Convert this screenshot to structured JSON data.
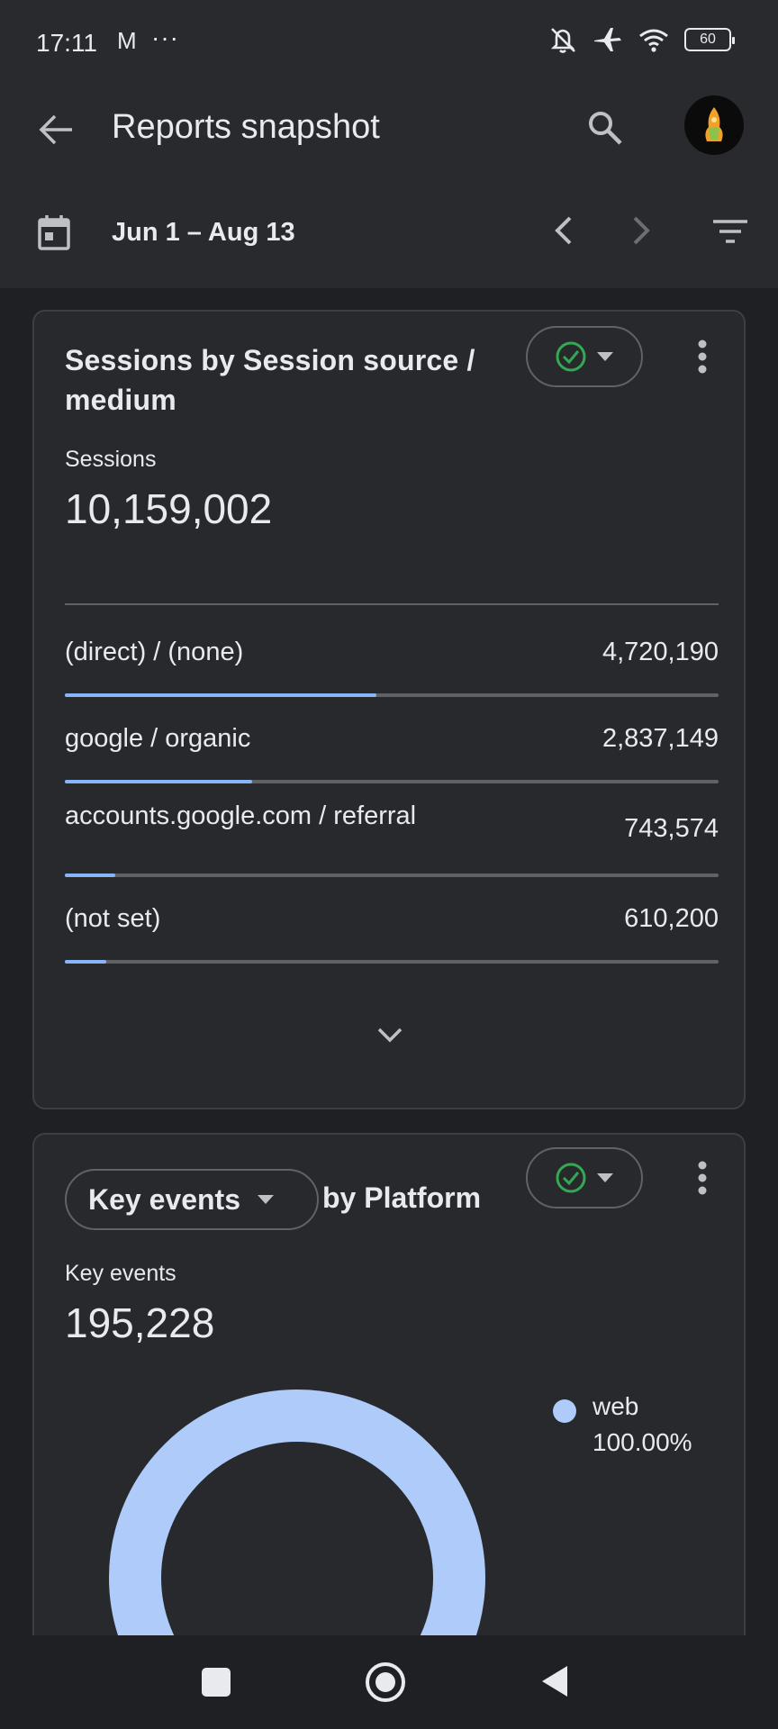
{
  "status_bar": {
    "time": "17:11",
    "mail_glyph": "M",
    "overflow_dots": "···",
    "battery": "60"
  },
  "app_bar": {
    "title": "Reports snapshot"
  },
  "date_bar": {
    "range": "Jun 1 – Aug 13"
  },
  "card_sessions": {
    "title": "Sessions by Session source / medium",
    "metric_label": "Sessions",
    "metric_value": "10,159,002",
    "rows": [
      {
        "label": "(direct) / (none)",
        "value": "4,720,190",
        "fraction": 0.477
      },
      {
        "label": "google / organic",
        "value": "2,837,149",
        "fraction": 0.287
      },
      {
        "label": "accounts.google.com / referral",
        "value": "743,574",
        "fraction": 0.077
      },
      {
        "label": "(not set)",
        "value": "610,200",
        "fraction": 0.063
      }
    ]
  },
  "card_key_events": {
    "dimension_select": "Key events",
    "by_text": "by Platform",
    "metric_label": "Key events",
    "metric_value": "195,228",
    "legend": [
      {
        "name": "web",
        "percent": "100.00%",
        "color": "#aecbfa"
      }
    ]
  },
  "colors": {
    "accent_bar": "#8ab4f8",
    "donut": "#aecbfa",
    "success_check": "#34a853"
  }
}
